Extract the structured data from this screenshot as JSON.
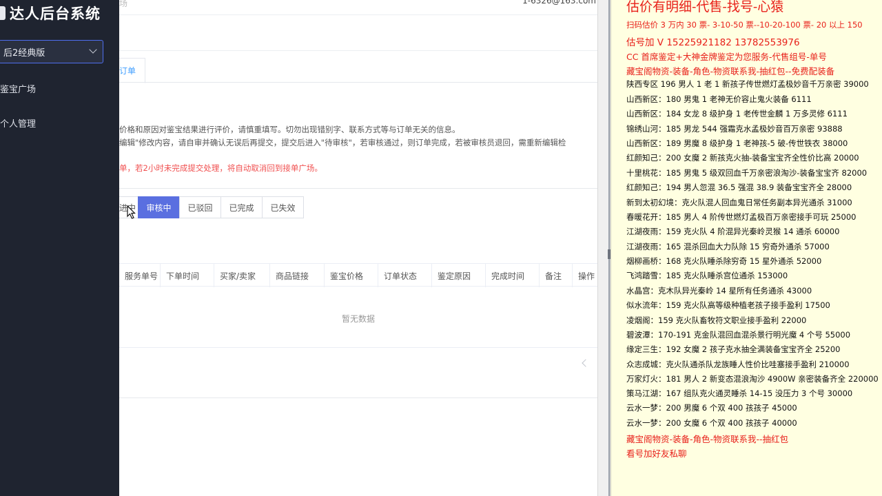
{
  "sidebar": {
    "title": "达人后台系统",
    "version_select": "后2经典版",
    "nav": [
      {
        "label": "鉴宝广场"
      },
      {
        "label": "个人管理"
      }
    ]
  },
  "header": {
    "email_fragment": "1-6326@163.com",
    "faded_fragment": "场"
  },
  "tabs": [
    {
      "label": "订单"
    }
  ],
  "notices": {
    "line1": "价格和原因对鉴宝结果进行评价，请慎重填写。切勿出现错别字、联系方式等与订单无关的信息。",
    "line2": "编辑\"修改内容，请自审并确认无误后再提交，提交后进入\"待审核\"，若审核通过，则订单完成，若被审核员退回，需重新编辑检",
    "red_line": "单，若2小时未完成提交处理，将自动取消回到接单广场。"
  },
  "status_filters": [
    {
      "label": "进中",
      "active": false
    },
    {
      "label": "审核中",
      "active": true
    },
    {
      "label": "已驳回",
      "active": false
    },
    {
      "label": "已完成",
      "active": false
    },
    {
      "label": "已失效",
      "active": false
    }
  ],
  "table": {
    "columns": [
      "服务单号",
      "下单时间",
      "买家/卖家",
      "商品链接",
      "鉴宝价格",
      "订单状态",
      "鉴定原因",
      "完成时间",
      "备注",
      "操作"
    ],
    "empty_text": "暂无数据"
  },
  "document": {
    "title": "估价有明细-代售-找号-心猿",
    "lines": [
      {
        "text": "扫码估价 3 万内 30 票- 3-10-50 票--10-20-100 票- 20 以上 150",
        "style": "red"
      },
      {
        "text": "估号加 V 15225921182   13782553976",
        "style": "red big"
      },
      {
        "text": "CC 首席鉴定+大神金牌鉴定为您服务-代售组号-单号",
        "style": "red mid"
      },
      {
        "text": "藏宝阁物资-装备-角色-物资联系我-抽红包--免费配装备",
        "style": "red mid"
      },
      {
        "text": "陕西专区 196 男人 1 老 1 新孩子传世燃灯孟极妙音千万亲密 39000",
        "style": ""
      },
      {
        "text": "山西新区：180 男鬼 1 老神无价容止鬼火装备 6111",
        "style": ""
      },
      {
        "text": "山西新区：184 女龙 8 级护身 1 老传世金麟 1 万多灵修 6111",
        "style": ""
      },
      {
        "text": "锦绣山河：185 男龙 544 强霜克水孟极妙音百万亲密 93888",
        "style": ""
      },
      {
        "text": "山西新区：189 男魔 8 级护身 1 老神孩-5 破-传世铁衣 38000",
        "style": ""
      },
      {
        "text": "红颜知己：200 女魔 2 新孩克火抽-装备宝宝齐全性价比高 20000",
        "style": ""
      },
      {
        "text": "十里桃花：185 男鬼 5 级双回血千万亲密浪淘沙-装备宝宝齐 82000",
        "style": ""
      },
      {
        "text": "红颜知己：194 男人忽混 36.5 强混 38.9 装备宝宝齐全 28000",
        "style": ""
      },
      {
        "text": "新到太初幻境：克火队混人回血鬼日常任务副本异光通杀 31000",
        "style": ""
      },
      {
        "text": "春暖花开：185 男人 4 阶传世燃灯孟极百万亲密接手可玩 25000",
        "style": ""
      },
      {
        "text": "江湖夜雨：159 克火队 4 阶混异光秦岭灵猴 14 通杀 60000",
        "style": ""
      },
      {
        "text": "江湖夜雨：165 混杀回血大力队除 15 穷奇外通杀 57000",
        "style": ""
      },
      {
        "text": "烟柳画桥：168 克火队睡杀除穷奇 15 星外通杀 52000",
        "style": ""
      },
      {
        "text": "飞鸿踏雪：185 克火队睡杀宫位通杀 153000",
        "style": ""
      },
      {
        "text": "水晶宫：克木队异光秦岭 14 星所有任务通杀 43000",
        "style": ""
      },
      {
        "text": "似水流年：159 克火队高等级种植老孩子接手盈利 17500",
        "style": ""
      },
      {
        "text": "凌烟阁：159 克火队畜牧符文职业接手盈利 22000",
        "style": ""
      },
      {
        "text": "碧波潭：170-191 克金队混回血混杀景行明光魔 4 个号 55000",
        "style": ""
      },
      {
        "text": "缘定三生：192 女魔 2 孩子克水抽全满装备宝宝齐全 25200",
        "style": ""
      },
      {
        "text": "众志成城：克火队通杀队龙族睡人性价比哇塞接手盈利 210000",
        "style": ""
      },
      {
        "text": "万家灯火：181 男人 2 新变态混浪淘沙 4900W 亲密装备齐全 220000",
        "style": ""
      },
      {
        "text": "策马江湖：167 组队克火通灵睡杀 14-15 没压力 3 个号 30000",
        "style": ""
      },
      {
        "text": "云水一梦：200 男魔 6 个双 400 孩孩子 45000",
        "style": ""
      },
      {
        "text": "云水一梦：200 女魔 6 个双 400 孩孩子 40000",
        "style": ""
      },
      {
        "text": "藏宝阁物资-装备-角色-物资联系我--抽红包",
        "style": "red mid"
      },
      {
        "text": "看号加好友私聊",
        "style": "red mid"
      }
    ]
  }
}
